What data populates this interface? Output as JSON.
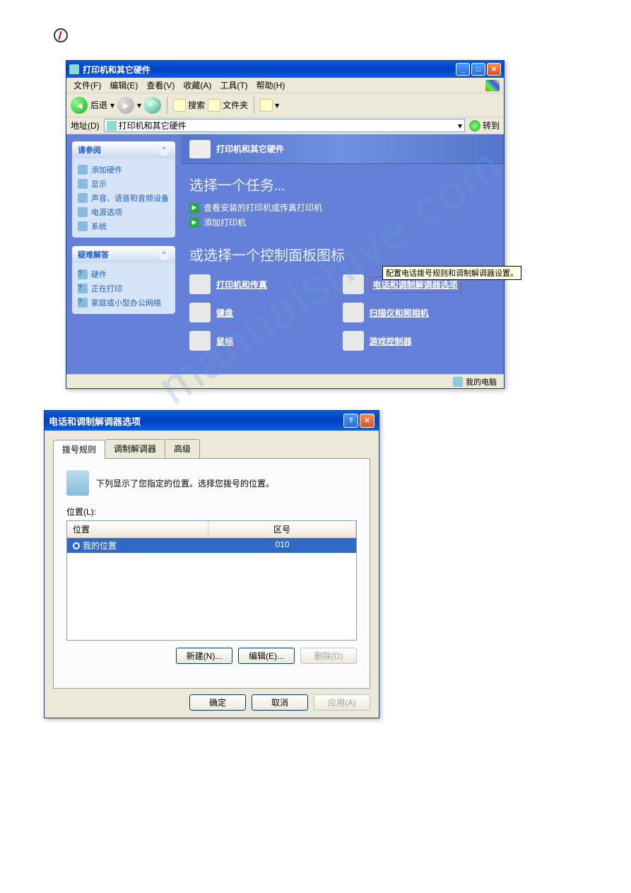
{
  "logo_alt": "brand-logo",
  "watermark": "manualshive.com",
  "window1": {
    "title": "打印机和其它硬件",
    "menu": {
      "file": "文件(F)",
      "edit": "编辑(E)",
      "view": "查看(V)",
      "fav": "收藏(A)",
      "tools": "工具(T)",
      "help": "帮助(H)"
    },
    "toolbar": {
      "back": "后退",
      "search": "搜索",
      "folders": "文件夹"
    },
    "addressbar": {
      "label": "地址(D)",
      "value": "打印机和其它硬件",
      "go": "转到"
    },
    "side": {
      "panel1": {
        "title": "请参阅",
        "items": [
          "添加硬件",
          "显示",
          "声音、语音和音频设备",
          "电源选项",
          "系统"
        ]
      },
      "panel2": {
        "title": "疑难解答",
        "items": [
          "硬件",
          "正在打印",
          "家庭或小型办公网络"
        ]
      }
    },
    "main": {
      "banner": "打印机和其它硬件",
      "task_heading": "选择一个任务...",
      "task1": "查看安装的打印机或传真打印机",
      "task2": "添加打印机",
      "icons_heading": "或选择一个控制面板图标",
      "icons": {
        "printers": "打印机和传真",
        "phone": "电话和调制解调器选项",
        "keyboard": "键盘",
        "scanner": "扫描仪和照相机",
        "mouse": "鼠标",
        "game": "游戏控制器"
      },
      "tooltip": "配置电话拨号规则和调制解调器设置。"
    },
    "statusbar": "我的电脑"
  },
  "window2": {
    "title": "电话和调制解调器选项",
    "tabs": {
      "t1": "拨号规则",
      "t2": "调制解调器",
      "t3": "高级"
    },
    "desc": "下列显示了您指定的位置。选择您拨号的位置。",
    "list_label": "位置(L):",
    "columns": {
      "loc": "位置",
      "area": "区号"
    },
    "row": {
      "name": "我的位置",
      "area": "010"
    },
    "buttons": {
      "new": "新建(N)...",
      "edit": "编辑(E)...",
      "delete": "删除(D)"
    },
    "footer": {
      "ok": "确定",
      "cancel": "取消",
      "apply": "应用(A)"
    }
  }
}
